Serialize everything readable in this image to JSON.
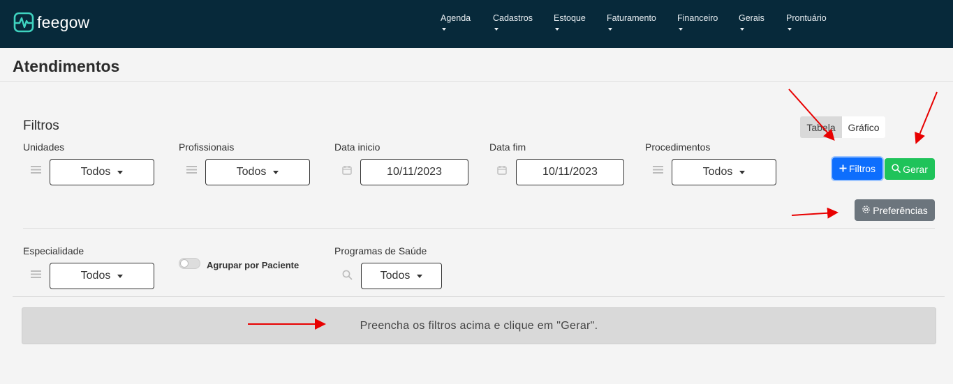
{
  "app": {
    "logo_text": "feegow"
  },
  "nav": {
    "items": [
      "Agenda",
      "Cadastros",
      "Estoque",
      "Faturamento",
      "Financeiro",
      "Gerais",
      "Prontuário"
    ]
  },
  "page": {
    "title": "Atendimentos"
  },
  "filters": {
    "title": "Filtros",
    "unidades": {
      "label": "Unidades",
      "value": "Todos"
    },
    "profissionais": {
      "label": "Profissionais",
      "value": "Todos"
    },
    "data_inicio": {
      "label": "Data inicio",
      "value": "10/11/2023"
    },
    "data_fim": {
      "label": "Data fim",
      "value": "10/11/2023"
    },
    "procedimentos": {
      "label": "Procedimentos",
      "value": "Todos"
    },
    "especialidade": {
      "label": "Especialidade",
      "value": "Todos"
    },
    "agrupar_por_paciente": {
      "label": "Agrupar por Paciente",
      "checked": false
    },
    "programas_de_saude": {
      "label": "Programas de Saúde",
      "value": "Todos"
    }
  },
  "view_toggle": {
    "tabela": "Tabela",
    "grafico": "Gráfico",
    "selected": "Tabela"
  },
  "buttons": {
    "filtros": "Filtros",
    "gerar": "Gerar",
    "preferencias": "Preferências"
  },
  "alert": {
    "message": "Preencha os filtros acima e clique em \"Gerar\"."
  },
  "colors": {
    "navbar": "#07293a",
    "logo_accent": "#3fd3c0",
    "primary": "#0d6efd",
    "success": "#1fc35a",
    "secondary": "#6c757d",
    "annotation_arrow": "#e80000"
  }
}
